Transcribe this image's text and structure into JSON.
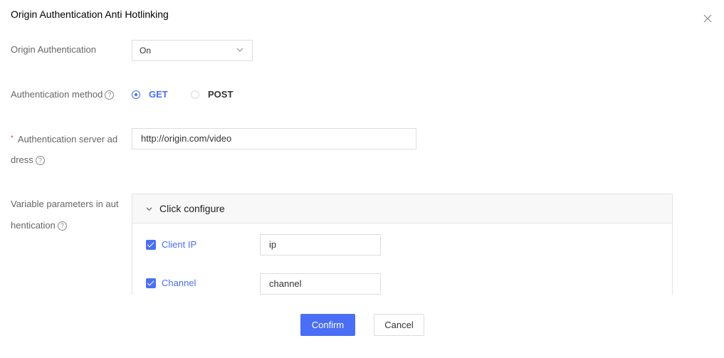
{
  "dialog": {
    "title": "Origin Authentication Anti Hotlinking",
    "close_icon": "close-icon"
  },
  "form": {
    "origin_auth": {
      "label": "Origin Authentication",
      "value": "On"
    },
    "auth_method": {
      "label": "Authentication method",
      "options": [
        {
          "label": "GET",
          "selected": true
        },
        {
          "label": "POST",
          "selected": false
        }
      ]
    },
    "server_address": {
      "required_mark": "*",
      "label_line1": "Authentication server ad",
      "label_line2": "dress",
      "value": "http://origin.com/video"
    },
    "variable_params": {
      "label_line1": "Variable parameters in aut",
      "label_line2": "hentication",
      "panel_title": "Click configure",
      "items": [
        {
          "label": "Client IP",
          "checked": true,
          "value": "ip"
        },
        {
          "label": "Channel",
          "checked": true,
          "value": "channel"
        }
      ]
    },
    "help_glyph": "?"
  },
  "footer": {
    "confirm_label": "Confirm",
    "cancel_label": "Cancel"
  },
  "colors": {
    "accent": "#4a6ef5",
    "required": "#e54545"
  }
}
